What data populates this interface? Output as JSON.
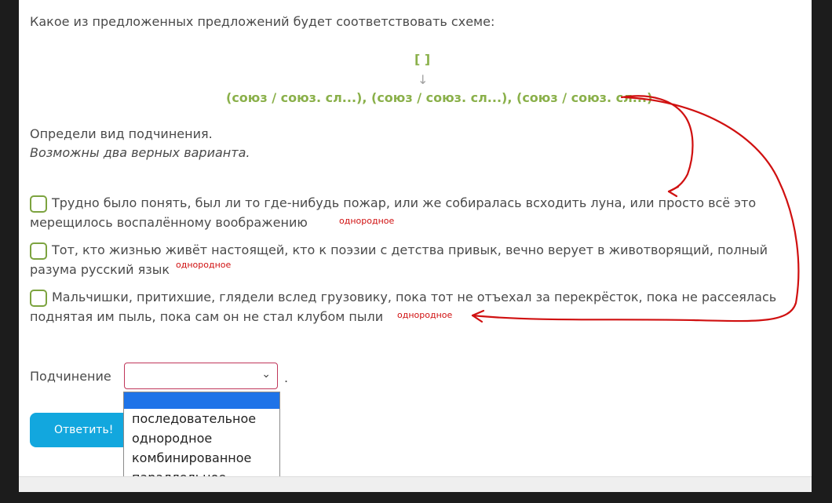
{
  "question": "Какое из предложенных предложений будет соответствовать схеме:",
  "scheme": {
    "bracket": "[  ]",
    "arrow": "↓",
    "line": "(союз / союз. сл...), (союз / союз. сл...), (союз / союз. сл...)"
  },
  "instruction": "Определи вид подчинения.",
  "hint": "Возможны два верных варианта.",
  "options": [
    {
      "line1": "Трудно было понять, был ли то где-нибудь пожар, или же собиралась всходить луна, или просто всё это",
      "line2": "мерещилось воспалённому воображению",
      "note": "однородное"
    },
    {
      "line1": "Тот, кто жизнью живёт настоящей, кто к поэзии с детства привык, вечно верует в животворящий, полный",
      "line2": "разума русский язык",
      "note": "однородное"
    },
    {
      "line1": "Мальчишки, притихшие, глядели вслед грузовику, пока тот не отъехал за перекрёсток, пока не рассеялась",
      "line2": "поднятая им пыль, пока сам он не стал клубом пыли",
      "note": "однородное"
    }
  ],
  "subordination": {
    "label": "Подчинение",
    "selected": "",
    "chevron": "⌄",
    "after": ".",
    "options": [
      "",
      "последовательное",
      "однородное",
      "комбинированное",
      "параллельное"
    ]
  },
  "answer_button": "Ответить!",
  "colors": {
    "scheme_green": "#8ab04a",
    "checkbox_green": "#7ca33f",
    "annotation_red": "#d01010",
    "button_blue": "#12a7de",
    "highlight_blue": "#1e73e8"
  },
  "icons": {
    "select_chevron": "chevron-down-icon"
  }
}
